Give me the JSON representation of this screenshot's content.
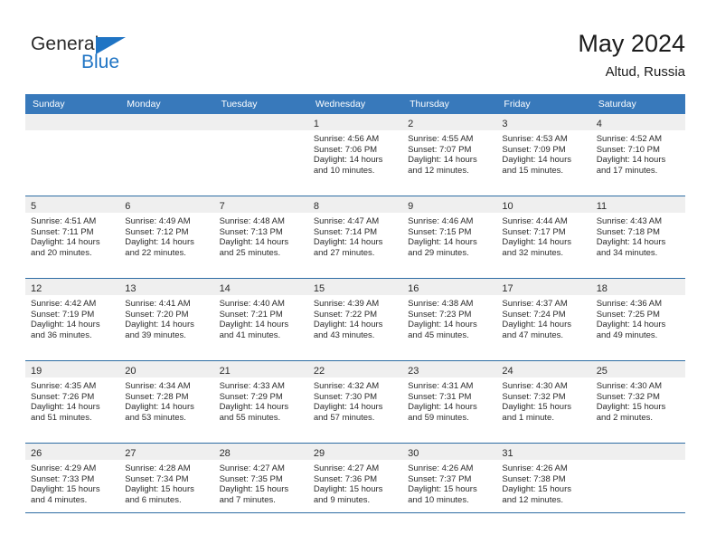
{
  "brand": {
    "name_top": "General",
    "name_bottom": "Blue",
    "triangle_icon": "triangle-icon",
    "color_dark": "#2b2b2b",
    "color_blue": "#1f74c4"
  },
  "header": {
    "title": "May 2024",
    "location": "Altud, Russia"
  },
  "theme": {
    "header_blue": "#3879bb",
    "rule_blue": "#2e6da4",
    "daystrip_gray": "#efefef",
    "text": "#2b2b2b"
  },
  "labels": {
    "sunrise_prefix": "Sunrise:",
    "sunset_prefix": "Sunset:",
    "daylight_prefix": "Daylight:"
  },
  "weekdays": [
    "Sunday",
    "Monday",
    "Tuesday",
    "Wednesday",
    "Thursday",
    "Friday",
    "Saturday"
  ],
  "weeks": [
    [
      {
        "day": ""
      },
      {
        "day": ""
      },
      {
        "day": ""
      },
      {
        "day": "1",
        "sunrise": "Sunrise: 4:56 AM",
        "sunset": "Sunset: 7:06 PM",
        "daylight1": "Daylight: 14 hours",
        "daylight2": "and 10 minutes."
      },
      {
        "day": "2",
        "sunrise": "Sunrise: 4:55 AM",
        "sunset": "Sunset: 7:07 PM",
        "daylight1": "Daylight: 14 hours",
        "daylight2": "and 12 minutes."
      },
      {
        "day": "3",
        "sunrise": "Sunrise: 4:53 AM",
        "sunset": "Sunset: 7:09 PM",
        "daylight1": "Daylight: 14 hours",
        "daylight2": "and 15 minutes."
      },
      {
        "day": "4",
        "sunrise": "Sunrise: 4:52 AM",
        "sunset": "Sunset: 7:10 PM",
        "daylight1": "Daylight: 14 hours",
        "daylight2": "and 17 minutes."
      }
    ],
    [
      {
        "day": "5",
        "sunrise": "Sunrise: 4:51 AM",
        "sunset": "Sunset: 7:11 PM",
        "daylight1": "Daylight: 14 hours",
        "daylight2": "and 20 minutes."
      },
      {
        "day": "6",
        "sunrise": "Sunrise: 4:49 AM",
        "sunset": "Sunset: 7:12 PM",
        "daylight1": "Daylight: 14 hours",
        "daylight2": "and 22 minutes."
      },
      {
        "day": "7",
        "sunrise": "Sunrise: 4:48 AM",
        "sunset": "Sunset: 7:13 PM",
        "daylight1": "Daylight: 14 hours",
        "daylight2": "and 25 minutes."
      },
      {
        "day": "8",
        "sunrise": "Sunrise: 4:47 AM",
        "sunset": "Sunset: 7:14 PM",
        "daylight1": "Daylight: 14 hours",
        "daylight2": "and 27 minutes."
      },
      {
        "day": "9",
        "sunrise": "Sunrise: 4:46 AM",
        "sunset": "Sunset: 7:15 PM",
        "daylight1": "Daylight: 14 hours",
        "daylight2": "and 29 minutes."
      },
      {
        "day": "10",
        "sunrise": "Sunrise: 4:44 AM",
        "sunset": "Sunset: 7:17 PM",
        "daylight1": "Daylight: 14 hours",
        "daylight2": "and 32 minutes."
      },
      {
        "day": "11",
        "sunrise": "Sunrise: 4:43 AM",
        "sunset": "Sunset: 7:18 PM",
        "daylight1": "Daylight: 14 hours",
        "daylight2": "and 34 minutes."
      }
    ],
    [
      {
        "day": "12",
        "sunrise": "Sunrise: 4:42 AM",
        "sunset": "Sunset: 7:19 PM",
        "daylight1": "Daylight: 14 hours",
        "daylight2": "and 36 minutes."
      },
      {
        "day": "13",
        "sunrise": "Sunrise: 4:41 AM",
        "sunset": "Sunset: 7:20 PM",
        "daylight1": "Daylight: 14 hours",
        "daylight2": "and 39 minutes."
      },
      {
        "day": "14",
        "sunrise": "Sunrise: 4:40 AM",
        "sunset": "Sunset: 7:21 PM",
        "daylight1": "Daylight: 14 hours",
        "daylight2": "and 41 minutes."
      },
      {
        "day": "15",
        "sunrise": "Sunrise: 4:39 AM",
        "sunset": "Sunset: 7:22 PM",
        "daylight1": "Daylight: 14 hours",
        "daylight2": "and 43 minutes."
      },
      {
        "day": "16",
        "sunrise": "Sunrise: 4:38 AM",
        "sunset": "Sunset: 7:23 PM",
        "daylight1": "Daylight: 14 hours",
        "daylight2": "and 45 minutes."
      },
      {
        "day": "17",
        "sunrise": "Sunrise: 4:37 AM",
        "sunset": "Sunset: 7:24 PM",
        "daylight1": "Daylight: 14 hours",
        "daylight2": "and 47 minutes."
      },
      {
        "day": "18",
        "sunrise": "Sunrise: 4:36 AM",
        "sunset": "Sunset: 7:25 PM",
        "daylight1": "Daylight: 14 hours",
        "daylight2": "and 49 minutes."
      }
    ],
    [
      {
        "day": "19",
        "sunrise": "Sunrise: 4:35 AM",
        "sunset": "Sunset: 7:26 PM",
        "daylight1": "Daylight: 14 hours",
        "daylight2": "and 51 minutes."
      },
      {
        "day": "20",
        "sunrise": "Sunrise: 4:34 AM",
        "sunset": "Sunset: 7:28 PM",
        "daylight1": "Daylight: 14 hours",
        "daylight2": "and 53 minutes."
      },
      {
        "day": "21",
        "sunrise": "Sunrise: 4:33 AM",
        "sunset": "Sunset: 7:29 PM",
        "daylight1": "Daylight: 14 hours",
        "daylight2": "and 55 minutes."
      },
      {
        "day": "22",
        "sunrise": "Sunrise: 4:32 AM",
        "sunset": "Sunset: 7:30 PM",
        "daylight1": "Daylight: 14 hours",
        "daylight2": "and 57 minutes."
      },
      {
        "day": "23",
        "sunrise": "Sunrise: 4:31 AM",
        "sunset": "Sunset: 7:31 PM",
        "daylight1": "Daylight: 14 hours",
        "daylight2": "and 59 minutes."
      },
      {
        "day": "24",
        "sunrise": "Sunrise: 4:30 AM",
        "sunset": "Sunset: 7:32 PM",
        "daylight1": "Daylight: 15 hours",
        "daylight2": "and 1 minute."
      },
      {
        "day": "25",
        "sunrise": "Sunrise: 4:30 AM",
        "sunset": "Sunset: 7:32 PM",
        "daylight1": "Daylight: 15 hours",
        "daylight2": "and 2 minutes."
      }
    ],
    [
      {
        "day": "26",
        "sunrise": "Sunrise: 4:29 AM",
        "sunset": "Sunset: 7:33 PM",
        "daylight1": "Daylight: 15 hours",
        "daylight2": "and 4 minutes."
      },
      {
        "day": "27",
        "sunrise": "Sunrise: 4:28 AM",
        "sunset": "Sunset: 7:34 PM",
        "daylight1": "Daylight: 15 hours",
        "daylight2": "and 6 minutes."
      },
      {
        "day": "28",
        "sunrise": "Sunrise: 4:27 AM",
        "sunset": "Sunset: 7:35 PM",
        "daylight1": "Daylight: 15 hours",
        "daylight2": "and 7 minutes."
      },
      {
        "day": "29",
        "sunrise": "Sunrise: 4:27 AM",
        "sunset": "Sunset: 7:36 PM",
        "daylight1": "Daylight: 15 hours",
        "daylight2": "and 9 minutes."
      },
      {
        "day": "30",
        "sunrise": "Sunrise: 4:26 AM",
        "sunset": "Sunset: 7:37 PM",
        "daylight1": "Daylight: 15 hours",
        "daylight2": "and 10 minutes."
      },
      {
        "day": "31",
        "sunrise": "Sunrise: 4:26 AM",
        "sunset": "Sunset: 7:38 PM",
        "daylight1": "Daylight: 15 hours",
        "daylight2": "and 12 minutes."
      },
      {
        "day": ""
      }
    ]
  ]
}
